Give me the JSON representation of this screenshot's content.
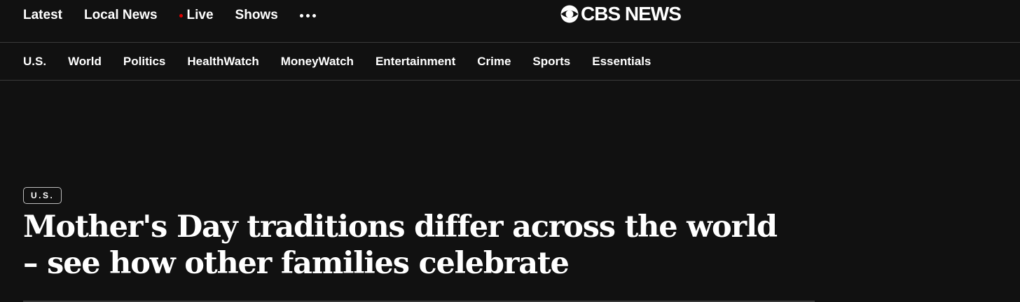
{
  "colors": {
    "background": "#111111",
    "text": "#ffffff",
    "live_dot": "#e00000",
    "divider": "#3a3a3a"
  },
  "top_nav": {
    "items": [
      {
        "label": "Latest"
      },
      {
        "label": "Local News"
      },
      {
        "label": "Live",
        "indicator_icon": "live-dot-icon"
      },
      {
        "label": "Shows"
      }
    ],
    "more_icon": "more-dots-icon"
  },
  "logo": {
    "icon": "cbs-eye-icon",
    "text": "CBS NEWS"
  },
  "section_nav": {
    "items": [
      {
        "label": "U.S."
      },
      {
        "label": "World"
      },
      {
        "label": "Politics"
      },
      {
        "label": "HealthWatch"
      },
      {
        "label": "MoneyWatch"
      },
      {
        "label": "Entertainment"
      },
      {
        "label": "Crime"
      },
      {
        "label": "Sports"
      },
      {
        "label": "Essentials"
      }
    ]
  },
  "article": {
    "category": "U.S.",
    "headline": "Mother's Day traditions differ across the world – see how other families celebrate"
  }
}
